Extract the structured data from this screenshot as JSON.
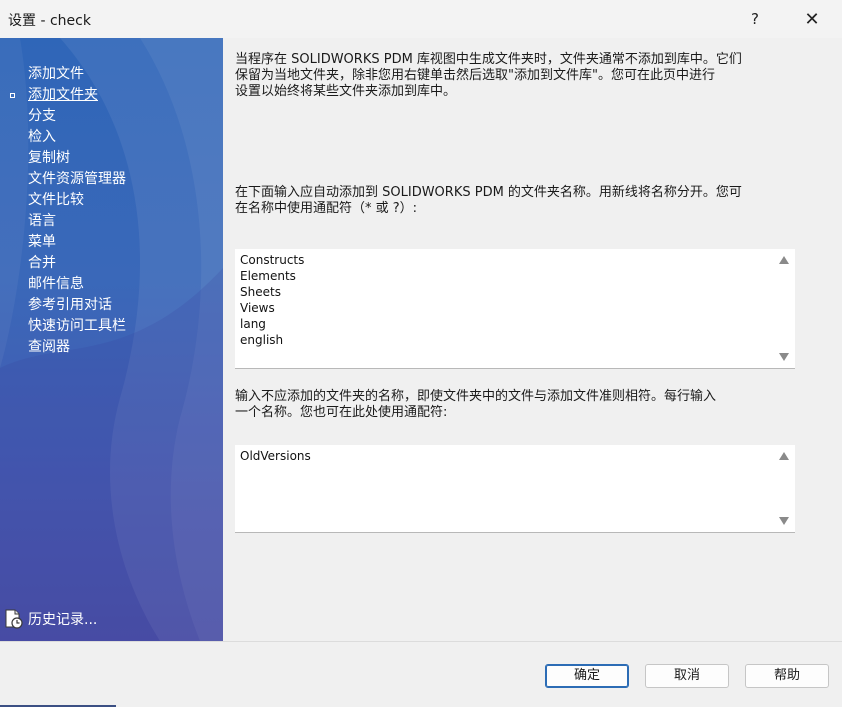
{
  "window": {
    "title": "设置 - check",
    "help_glyph": "?",
    "close_glyph": "✕"
  },
  "sidebar": {
    "items": [
      {
        "label": "添加文件",
        "active": false
      },
      {
        "label": "添加文件夹",
        "active": true
      },
      {
        "label": "分支",
        "active": false
      },
      {
        "label": "检入",
        "active": false
      },
      {
        "label": "复制树",
        "active": false
      },
      {
        "label": "文件资源管理器",
        "active": false
      },
      {
        "label": "文件比较",
        "active": false
      },
      {
        "label": "语言",
        "active": false
      },
      {
        "label": "菜单",
        "active": false
      },
      {
        "label": "合并",
        "active": false
      },
      {
        "label": "邮件信息",
        "active": false
      },
      {
        "label": "参考引用对话",
        "active": false
      },
      {
        "label": "快速访问工具栏",
        "active": false
      },
      {
        "label": "查阅器",
        "active": false
      }
    ],
    "history_label": "历史记录..."
  },
  "content": {
    "intro_lines": [
      "当程序在 SOLIDWORKS PDM 库视图中生成文件夹时，文件夹通常不添加到库中。它们",
      "保留为当地文件夹，除非您用右键单击然后选取\"添加到文件库\"。您可在此页中进行",
      "设置以始终将某些文件夹添加到库中。"
    ],
    "include_prompt_lines": [
      "在下面输入应自动添加到 SOLIDWORKS PDM 的文件夹名称。用新线将名称分开。您可",
      "在名称中使用通配符（* 或 ?）:"
    ],
    "include_list": [
      "Constructs",
      "Elements",
      "Sheets",
      "Views",
      "lang",
      "english"
    ],
    "exclude_prompt_lines": [
      "输入不应添加的文件夹的名称，即使文件夹中的文件与添加文件准则相符。每行输入",
      "一个名称。您也可在此处使用通配符:"
    ],
    "exclude_list": [
      "OldVersions"
    ]
  },
  "footer": {
    "ok_label": "确定",
    "cancel_label": "取消",
    "help_label": "帮助"
  },
  "colors": {
    "sidebar_top": "#2f66b8",
    "sidebar_bottom": "#4b4fa6",
    "accent": "#2c6cb5"
  }
}
